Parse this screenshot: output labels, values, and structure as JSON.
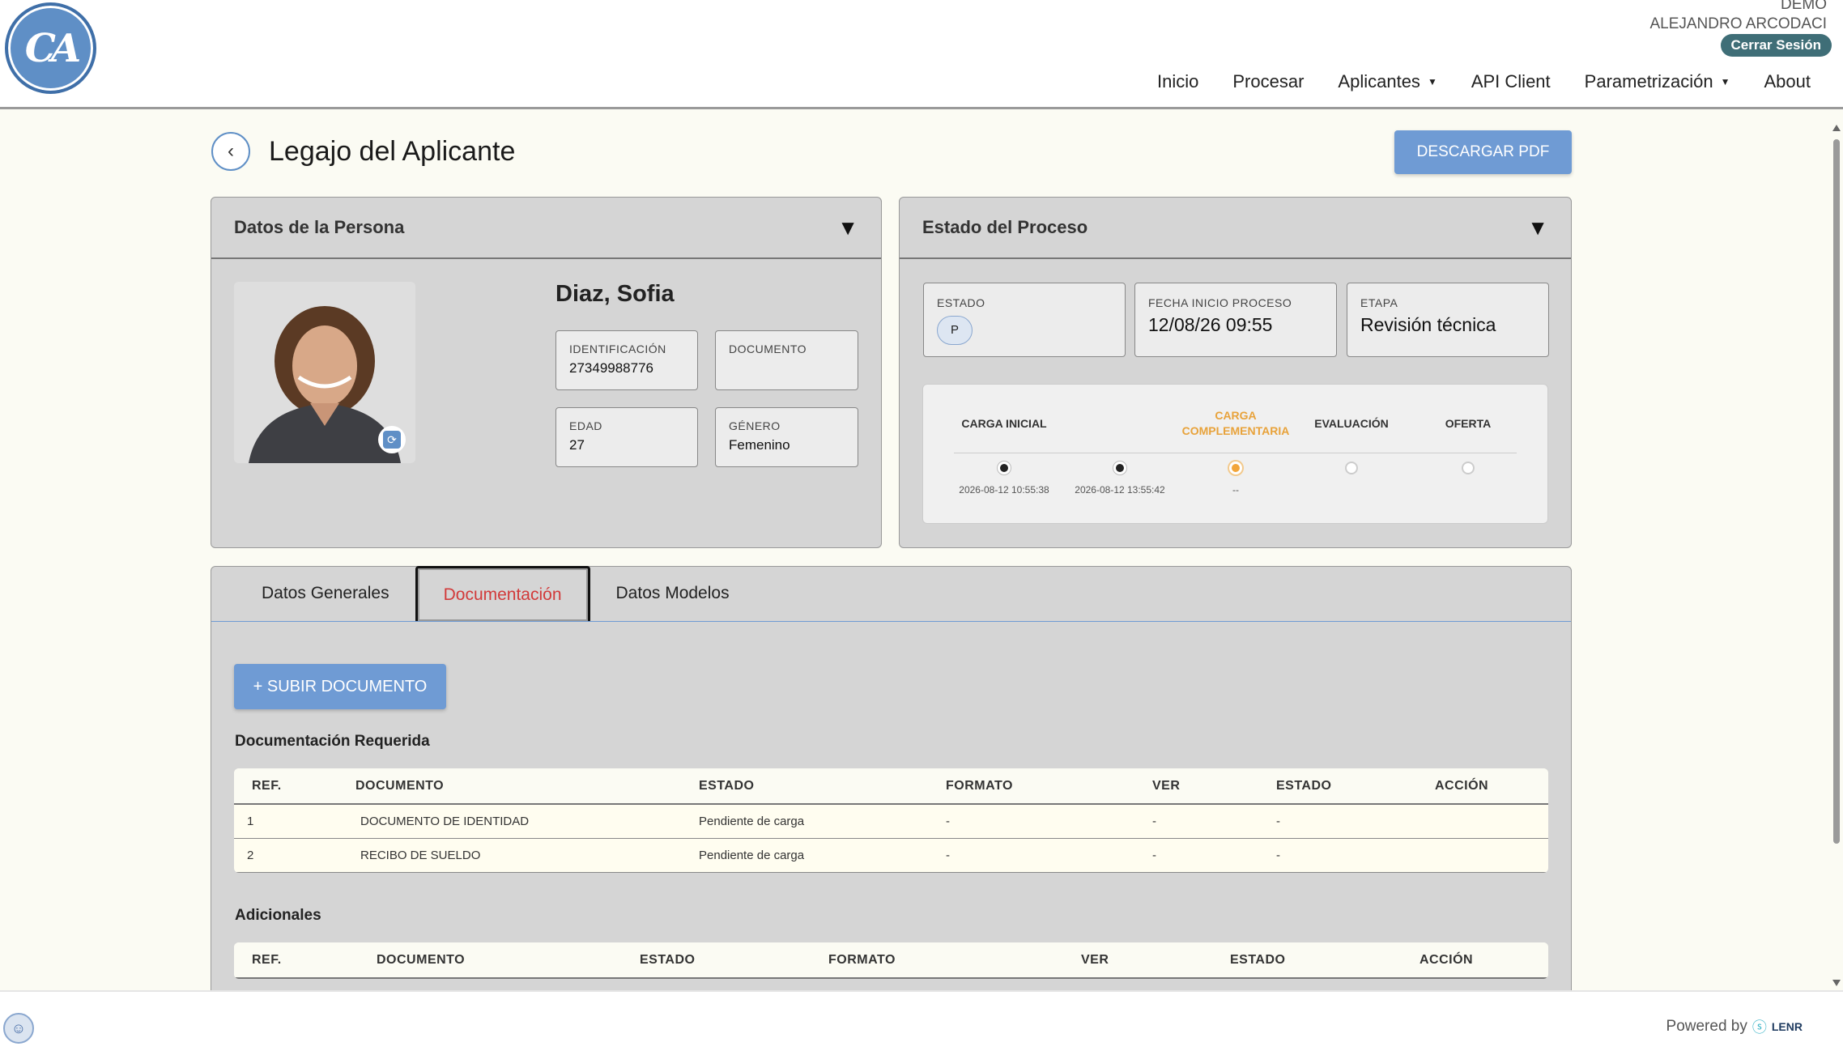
{
  "header": {
    "logo_text": "CA",
    "user_role": "DEMO",
    "user_name": "ALEJANDRO ARCODACI",
    "logout_label": "Cerrar Sesión",
    "nav": [
      {
        "label": "Inicio"
      },
      {
        "label": "Procesar"
      },
      {
        "label": "Aplicantes"
      },
      {
        "label": "API Client"
      },
      {
        "label": "Parametrización"
      },
      {
        "label": "About"
      }
    ]
  },
  "page": {
    "title": "Legajo del Aplicante",
    "download_label": "DESCARGAR PDF"
  },
  "person_card": {
    "title": "Datos de la Persona",
    "name": "Diaz, Sofia",
    "fields": {
      "id_label": "IDENTIFICACIÓN",
      "id_value": "27349988776",
      "doc_label": "DOCUMENTO",
      "doc_value": "",
      "age_label": "EDAD",
      "age_value": "27",
      "gender_label": "GÉNERO",
      "gender_value": "Femenino"
    }
  },
  "process_card": {
    "title": "Estado del Proceso",
    "status_label": "ESTADO",
    "status_value": "P",
    "start_label": "FECHA INICIO PROCESO",
    "start_value": "12/08/26 09:55",
    "stage_label": "ETAPA",
    "stage_value": "Revisión técnica",
    "steps": [
      {
        "label": "CARGA INICIAL",
        "date": "2026-08-12 10:55:38",
        "state": "done"
      },
      {
        "label": "",
        "date": "2026-08-12 13:55:42",
        "state": "done"
      },
      {
        "label": "CARGA COMPLEMENTARIA",
        "date": "--",
        "state": "active"
      },
      {
        "label": "EVALUACIÓN",
        "date": "",
        "state": "pending"
      },
      {
        "label": "OFERTA",
        "date": "",
        "state": "pending"
      }
    ]
  },
  "tabs": [
    {
      "label": "Datos Generales"
    },
    {
      "label": "Documentación"
    },
    {
      "label": "Datos Modelos"
    }
  ],
  "documents": {
    "upload_label": "+ SUBIR DOCUMENTO",
    "required_title": "Documentación Requerida",
    "required_headers": [
      "REF.",
      "DOCUMENTO",
      "ESTADO",
      "FORMATO",
      "VER",
      "ESTADO",
      "ACCIÓN"
    ],
    "required_rows": [
      {
        "ref": "1",
        "doc": "DOCUMENTO DE IDENTIDAD",
        "status": "Pendiente de carga",
        "format": "-",
        "view": "-",
        "state": "-",
        "action": ""
      },
      {
        "ref": "2",
        "doc": "RECIBO DE SUELDO",
        "status": "Pendiente de carga",
        "format": "-",
        "view": "-",
        "state": "-",
        "action": ""
      }
    ],
    "additional_title": "Adicionales",
    "additional_headers": [
      "REF.",
      "DOCUMENTO",
      "ESTADO",
      "FORMATO",
      "VER",
      "ESTADO",
      "ACCIÓN"
    ]
  },
  "footer": {
    "powered_label": "Powered by",
    "brand": "LENR"
  },
  "colors": {
    "accent": "#6f9bd4",
    "pending": "#d23a3a",
    "active_step": "#f2a53a",
    "logout": "#3f6e77"
  }
}
